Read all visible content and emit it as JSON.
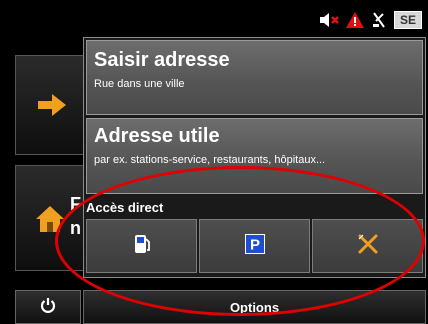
{
  "status": {
    "icons": [
      "speaker-muted-icon",
      "warning-icon",
      "satellite-icon"
    ],
    "language": "SE"
  },
  "background": {
    "nav_text_line1": "F",
    "nav_text_line2": "n"
  },
  "popup": {
    "items": [
      {
        "title": "Saisir adresse",
        "subtitle": "Rue dans une ville"
      },
      {
        "title": "Adresse utile",
        "subtitle": "par ex. stations-service, restaurants, hôpitaux..."
      }
    ],
    "direct_access": {
      "label": "Accès direct",
      "buttons": [
        "fuel-station-icon",
        "parking-icon",
        "restaurant-icon"
      ]
    }
  },
  "footer": {
    "options_label": "Options",
    "power_icon": "power-icon"
  },
  "colors": {
    "accent_orange": "#f0a020",
    "parking_blue": "#1f4fd0",
    "annotation_red": "#e00000",
    "menu_gray": "#5e5e5e"
  }
}
